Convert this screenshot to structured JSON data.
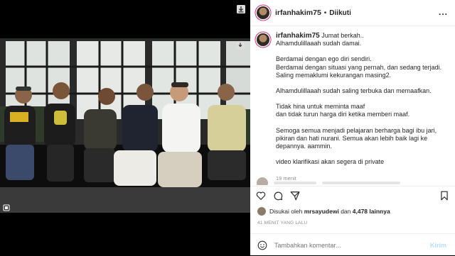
{
  "header": {
    "username": "irfanhakim75",
    "separator": "•",
    "follow_label": "Diikuti",
    "more_label": "..."
  },
  "caption": {
    "username": "irfanhakim75",
    "lines": [
      "Jumat berkah..",
      "Alhamdulillaaah sudah damai.",
      "",
      "Berdamai dengan ego diri sendiri.",
      "Berdamai dengan situasi yang pernah, dan sedang terjadi.",
      "Saling memaklumi kekurangan masing2.",
      "",
      "Alhamdulillaaah sudah saling terbuka dan memaafkan.",
      "",
      "Tidak hina untuk meminta maaf",
      "dan tidak turun harga diri ketika memberi maaf.",
      "",
      "Semoga semua menjadi pelajaran berharga bagi ibu jari,",
      "pikiran dan hati nurani. Semua akan lebih baik lagi ke",
      "depannya. aammin.",
      "",
      "video klarifikasi akan segera di private"
    ],
    "time": "19 menit"
  },
  "likes": {
    "prefix": "Disukai oleh",
    "user": "mrsayudewi",
    "middle": "dan",
    "count": "4,478 lainnya"
  },
  "posted_ago": "41 MENIT YANG LALU",
  "comment_box": {
    "placeholder": "Tambahkan komentar...",
    "post_label": "Kirim"
  },
  "colors": {
    "accent_blue": "#0095f6",
    "post_disabled": "#b2dffc",
    "muted_text": "#8e8e8e"
  },
  "icons": {
    "header_more": "ellipsis-icon",
    "like": "heart-icon",
    "comment": "comment-icon",
    "share": "paper-plane-icon",
    "save": "bookmark-icon",
    "emoji": "smiley-icon"
  }
}
